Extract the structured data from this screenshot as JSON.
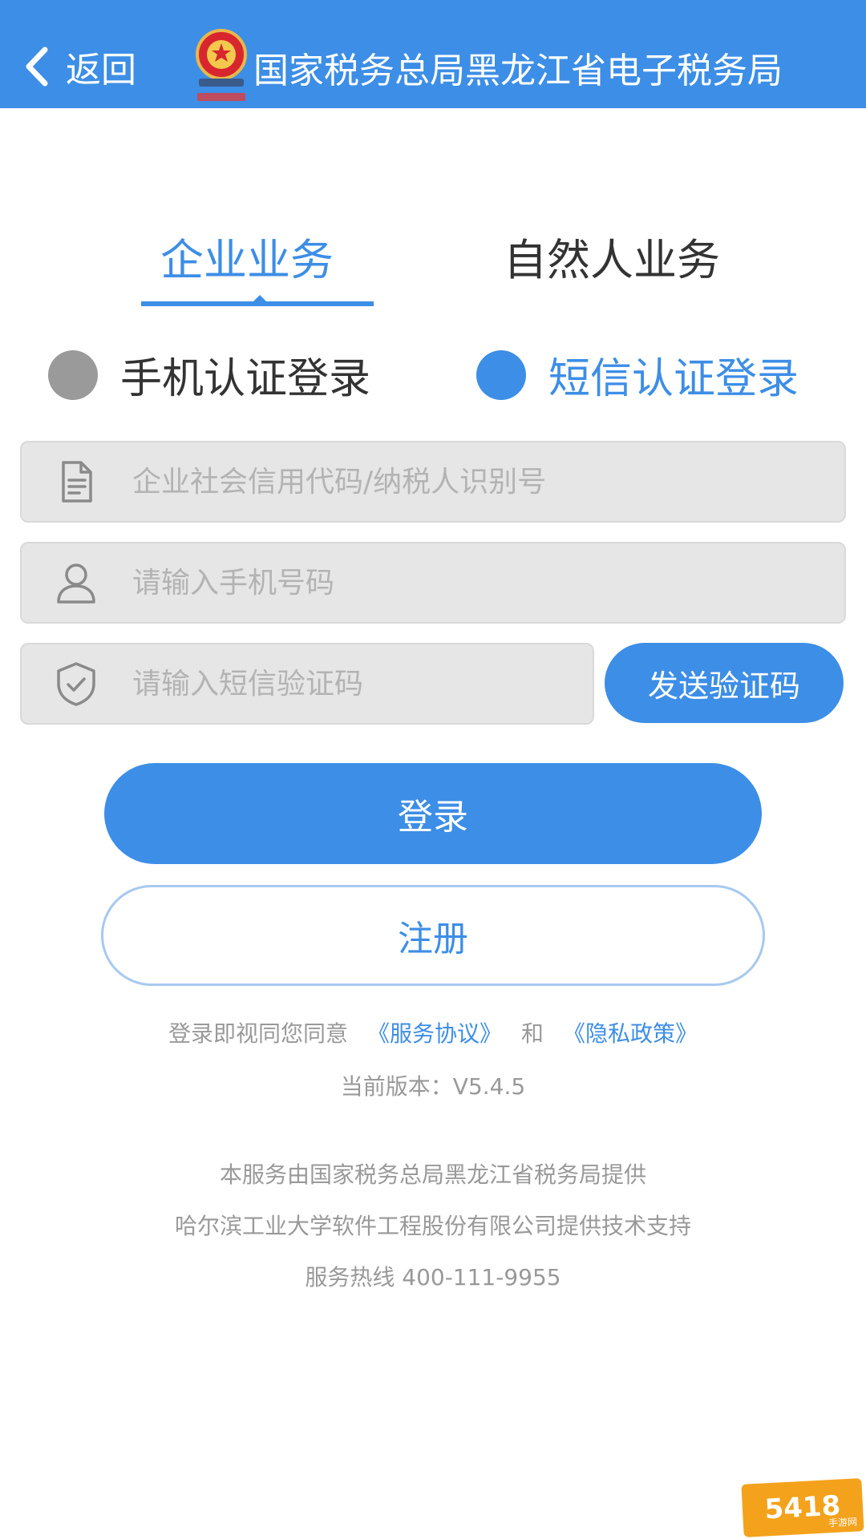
{
  "header": {
    "back_label": "返回",
    "title": "国家税务总局黑龙江省电子税务局",
    "background": "#3d8ee6"
  },
  "tabs": [
    {
      "label": "企业业务",
      "active": true
    },
    {
      "label": "自然人业务",
      "active": false
    }
  ],
  "login_methods": [
    {
      "label": "手机认证登录",
      "selected": false,
      "dot_color": "#9a9a9a"
    },
    {
      "label": "短信认证登录",
      "selected": true,
      "dot_color": "#3d8ee6"
    }
  ],
  "fields": {
    "credit_code": {
      "placeholder": "企业社会信用代码/纳税人识别号",
      "icon": "document-icon"
    },
    "phone": {
      "placeholder": "请输入手机号码",
      "icon": "user-icon"
    },
    "sms_code": {
      "placeholder": "请输入短信验证码",
      "icon": "shield-check-icon"
    }
  },
  "buttons": {
    "send_code": "发送验证码",
    "login": "登录",
    "register": "注册"
  },
  "agreement": {
    "prefix": "登录即视同您同意",
    "service_link": "《服务协议》",
    "and": "和",
    "privacy_link": "《隐私政策》"
  },
  "version_text": "当前版本：V5.4.5",
  "footer": {
    "line1": "本服务由国家税务总局黑龙江省税务局提供",
    "line2": "哈尔滨工业大学软件工程股份有限公司提供技术支持",
    "line3": "服务热线 400-111-9955"
  },
  "watermark": {
    "main": "5418",
    "sub": "手游网"
  },
  "colors": {
    "accent": "#3d8ee6",
    "muted_text": "#999999",
    "field_bg": "#e6e6e6"
  }
}
